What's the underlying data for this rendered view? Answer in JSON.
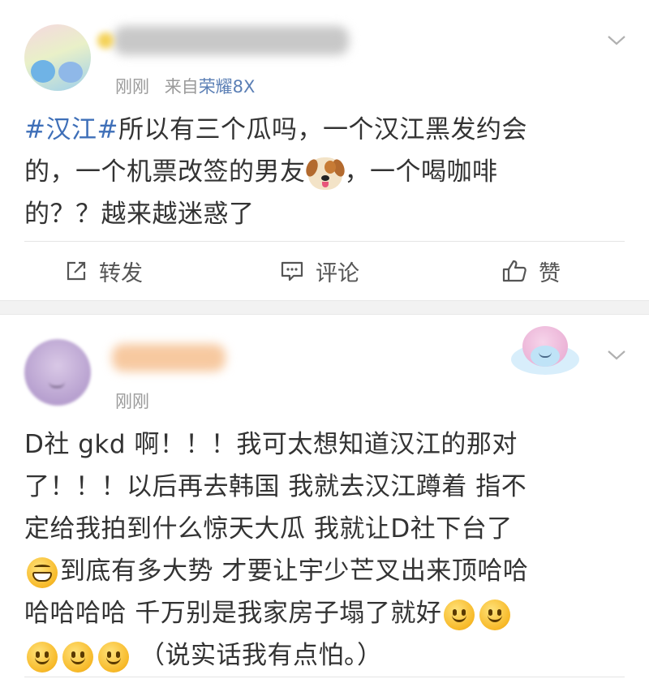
{
  "post1": {
    "meta_time": "刚刚",
    "meta_from": "来自",
    "meta_source": "荣耀8X",
    "hashtag": "#汉江#",
    "text_line1_rest": "所以有三个瓜吗，一个汉江黑发约会",
    "text_line2_a": "的，一个机票改签的男友",
    "text_line2_b": "，一个喝咖啡",
    "text_line3": "的？？越来越迷惑了",
    "actions": {
      "repost_label": "转发",
      "comment_label": "评论",
      "like_label": "赞"
    }
  },
  "post2": {
    "meta_time": "刚刚",
    "line1": "D社 gkd 啊！！！我可太想知道汉江的那对",
    "line2": "了！！！以后再去韩国 我就去汉江蹲着 指不",
    "line3": "定给我拍到什么惊天大瓜 我就让D社下台了",
    "line4": "到底有多大势 才要让宇少芒叉出来顶哈哈",
    "line5": "哈哈哈哈 千万别是我家房子塌了就好",
    "line6": "（说实话我有点怕。）"
  },
  "colors": {
    "hashtag": "#3e6fb8",
    "source_link": "#5b7fb5",
    "meta": "#9a9a9a",
    "separator": "#f2f2f2"
  },
  "icons": [
    "chevron-down-icon",
    "repost-icon",
    "comment-icon",
    "like-icon",
    "dog-emoji-icon",
    "grin-emoji-icon",
    "smile-emoji-icon"
  ]
}
